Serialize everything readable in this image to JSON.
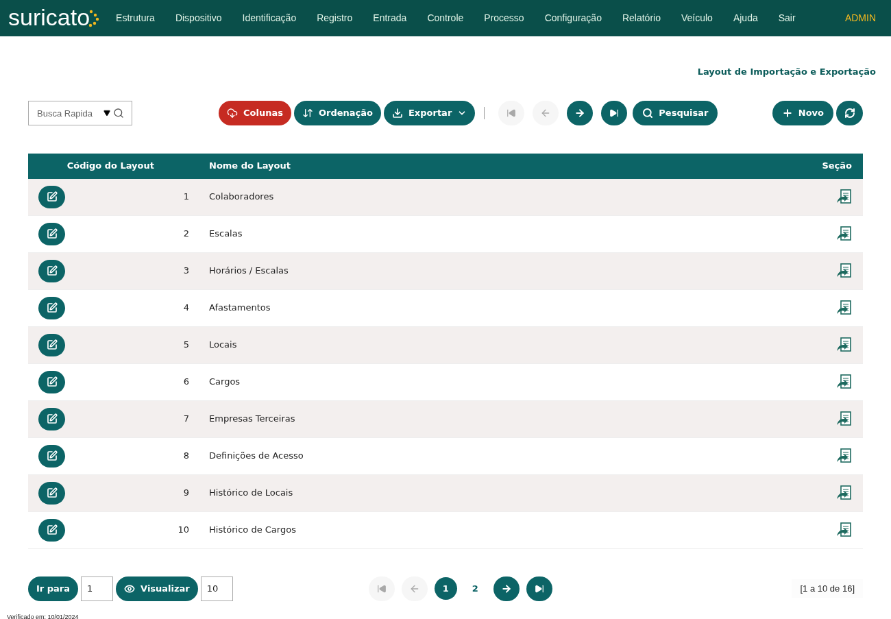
{
  "header": {
    "logo": "suricato",
    "menu": [
      "Estrutura",
      "Dispositivo",
      "Identificação",
      "Registro",
      "Entrada",
      "Controle",
      "Processo",
      "Configuração",
      "Relatório",
      "Veículo",
      "Ajuda",
      "Sair"
    ],
    "user": "ADMIN"
  },
  "page_title": "Layout de Importação e Exportação",
  "toolbar": {
    "search": {
      "placeholder": "Busca Rapida"
    },
    "actions": [
      {
        "kind": "columns",
        "label": "Colunas"
      },
      {
        "kind": "sort",
        "label": "Ordenação"
      },
      {
        "kind": "export",
        "label": "Exportar"
      }
    ],
    "nav": [
      {
        "kind": "first",
        "disabled": true
      },
      {
        "kind": "prev",
        "disabled": true
      },
      {
        "kind": "next",
        "disabled": false
      },
      {
        "kind": "last",
        "disabled": false
      }
    ],
    "search_button": "Pesquisar",
    "new_button": "Novo"
  },
  "table": {
    "columns": [
      "Código do Layout",
      "Nome do Layout",
      "Seção"
    ],
    "rows": [
      {
        "code": "1",
        "name": "Colaboradores"
      },
      {
        "code": "2",
        "name": "Escalas"
      },
      {
        "code": "3",
        "name": "Horários / Escalas"
      },
      {
        "code": "4",
        "name": "Afastamentos"
      },
      {
        "code": "5",
        "name": "Locais"
      },
      {
        "code": "6",
        "name": "Cargos"
      },
      {
        "code": "7",
        "name": "Empresas Terceiras"
      },
      {
        "code": "8",
        "name": "Definições de Acesso"
      },
      {
        "code": "9",
        "name": "Histórico de Locais"
      },
      {
        "code": "10",
        "name": "Histórico de Cargos"
      }
    ]
  },
  "footer": {
    "goto_button": "Ir para",
    "goto_value": "1",
    "view_button": "Visualizar",
    "view_value": "10",
    "nav": [
      {
        "kind": "first",
        "disabled": true
      },
      {
        "kind": "prev",
        "disabled": true
      },
      {
        "kind": "next",
        "disabled": false
      },
      {
        "kind": "last",
        "disabled": false
      }
    ],
    "pages": [
      {
        "label": "1",
        "selected": true
      },
      {
        "label": "2",
        "selected": false
      }
    ],
    "range": "[1 a 10 de 16]"
  },
  "verified": "Verificado em: 10/01/2024"
}
